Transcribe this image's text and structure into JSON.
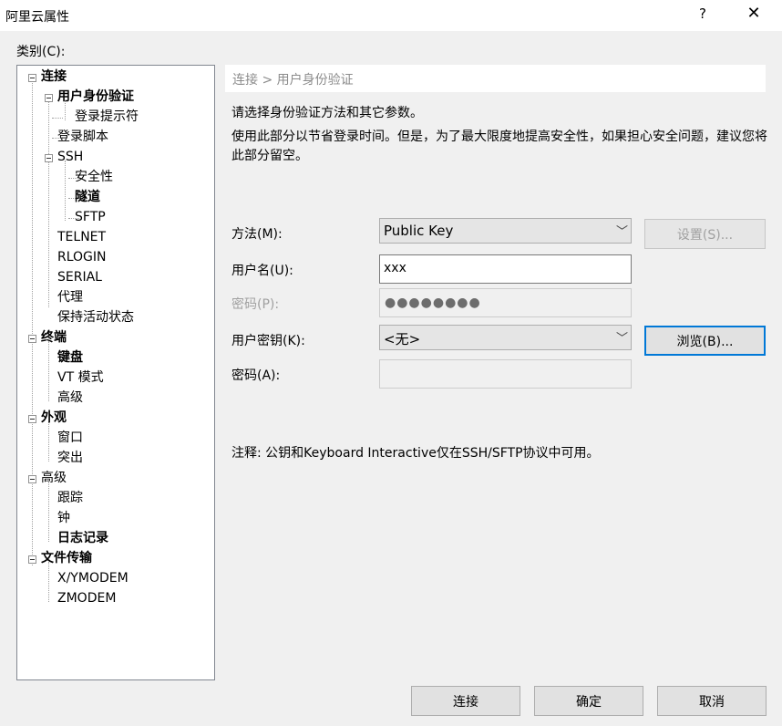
{
  "window": {
    "title": "阿里云属性",
    "help": "?",
    "close": "✕"
  },
  "category_label": "类别(C):",
  "tree": [
    {
      "label": "连接",
      "bold": true
    },
    {
      "label": "用户身份验证",
      "bold": true
    },
    {
      "label": "登录提示符",
      "bold": false
    },
    {
      "label": "登录脚本",
      "bold": false
    },
    {
      "label": "SSH",
      "bold": false
    },
    {
      "label": "安全性",
      "bold": false
    },
    {
      "label": "隧道",
      "bold": true
    },
    {
      "label": "SFTP",
      "bold": false
    },
    {
      "label": "TELNET",
      "bold": false
    },
    {
      "label": "RLOGIN",
      "bold": false
    },
    {
      "label": "SERIAL",
      "bold": false
    },
    {
      "label": "代理",
      "bold": false
    },
    {
      "label": "保持活动状态",
      "bold": false
    },
    {
      "label": "终端",
      "bold": true
    },
    {
      "label": "键盘",
      "bold": true
    },
    {
      "label": "VT 模式",
      "bold": false
    },
    {
      "label": "高级",
      "bold": false
    },
    {
      "label": "外观",
      "bold": true
    },
    {
      "label": "窗口",
      "bold": false
    },
    {
      "label": "突出",
      "bold": false
    },
    {
      "label": "高级",
      "bold": false
    },
    {
      "label": "跟踪",
      "bold": false
    },
    {
      "label": "钟",
      "bold": false
    },
    {
      "label": "日志记录",
      "bold": true
    },
    {
      "label": "文件传输",
      "bold": true
    },
    {
      "label": "X/YMODEM",
      "bold": false
    },
    {
      "label": "ZMODEM",
      "bold": false
    }
  ],
  "panel": {
    "breadcrumb": "连接 > 用户身份验证",
    "desc1": "请选择身份验证方法和其它参数。",
    "desc2": "使用此部分以节省登录时间。但是，为了最大限度地提高安全性，如果担心安全问题，建议您将此部分留空。",
    "method_label": "方法(M):",
    "method_value": "Public Key",
    "settings_button": "设置(S)...",
    "username_label": "用户名(U):",
    "username_value": "xxx",
    "password_label": "密码(P):",
    "password_mask": "●●●●●●●●",
    "userkey_label": "用户密钥(K):",
    "userkey_value": "<无>",
    "browse_button": "浏览(B)...",
    "passphrase_label": "密码(A):",
    "note": "注释: 公钥和Keyboard Interactive仅在SSH/SFTP协议中可用。"
  },
  "footer": {
    "connect": "连接",
    "ok": "确定",
    "cancel": "取消"
  },
  "colors": {
    "focus": "#0078d7",
    "disabled_text": "#a0a0a0"
  }
}
